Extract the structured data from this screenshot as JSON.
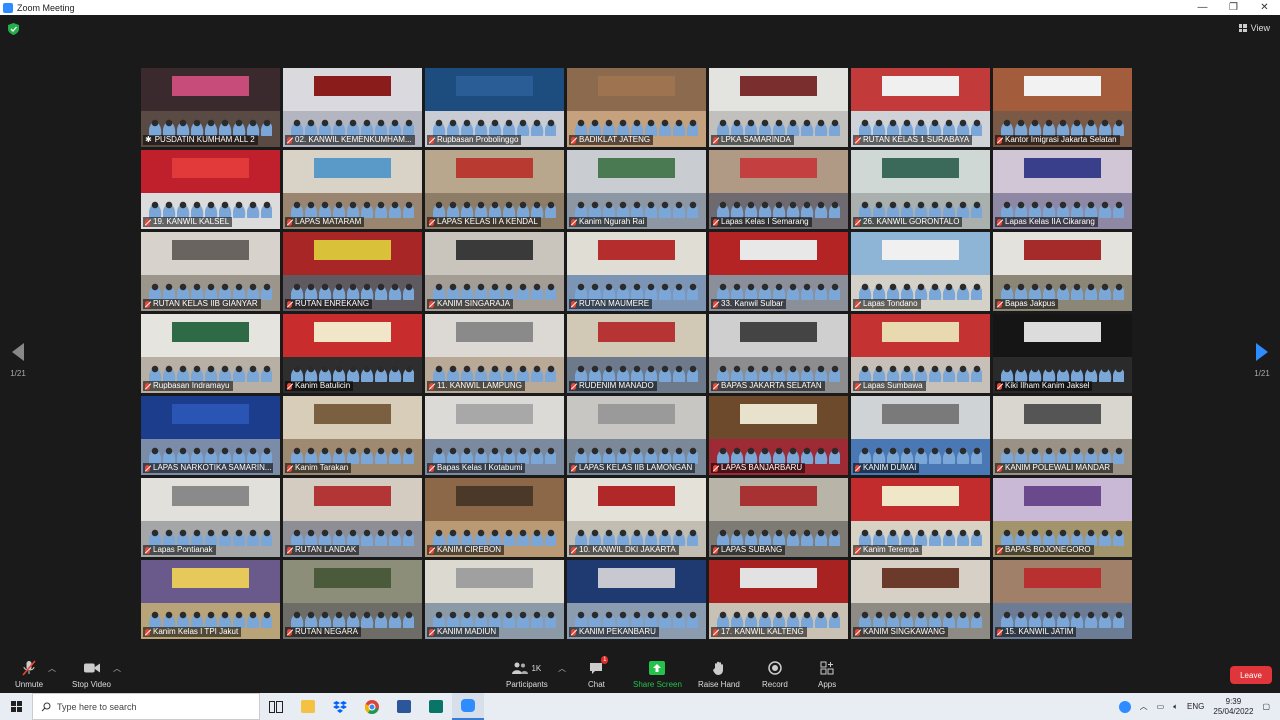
{
  "window": {
    "title": "Zoom Meeting",
    "controls": [
      "—",
      "❐",
      "✕"
    ]
  },
  "view": {
    "label": "View"
  },
  "pagination": {
    "left": "1/21",
    "right": "1/21"
  },
  "tiles": [
    {
      "label": "PUSDATIN KUMHAM ALL 2",
      "wall": "#3a2a2e",
      "floor": "#5a4a44",
      "banner": "#c84c7a",
      "active": true,
      "muted": false
    },
    {
      "label": "02. KANWIL KEMENKUMHAM...",
      "wall": "#d9d9de",
      "floor": "#b3b6c0",
      "banner": "#8a1c1c",
      "muted": true
    },
    {
      "label": "Rupbasan Probolinggo",
      "wall": "#1d4c7e",
      "floor": "#c9ccd3",
      "banner": "#2a5d95",
      "muted": true
    },
    {
      "label": "BADIKLAT JATENG",
      "wall": "#8b6a4e",
      "floor": "#c6a17e",
      "banner": "#9e7350",
      "muted": true
    },
    {
      "label": "LPKA SAMARINDA",
      "wall": "#e3e3e0",
      "floor": "#c2c0bc",
      "banner": "#7a2e2e",
      "muted": true
    },
    {
      "label": "RUTAN KELAS 1 SURABAYA",
      "wall": "#c33a3a",
      "floor": "#cfd2d6",
      "banner": "#f0f0f0",
      "muted": true
    },
    {
      "label": "Kantor Imigrasi Jakarta Selatan",
      "wall": "#a35c3c",
      "floor": "#7a5a46",
      "banner": "#f2f2f2",
      "muted": true
    },
    {
      "label": "19. KANWIL KALSEL",
      "wall": "#c0202c",
      "floor": "#dcdcdc",
      "banner": "#e23a3a",
      "muted": true
    },
    {
      "label": "LAPAS MATARAM",
      "wall": "#d8d2c7",
      "floor": "#9a8670",
      "banner": "#5a9ac8",
      "muted": true
    },
    {
      "label": "LAPAS KELAS II A KENDAL",
      "wall": "#b8a78c",
      "floor": "#8e7d66",
      "banner": "#b83a30",
      "muted": true
    },
    {
      "label": "Kanim Ngurah Rai",
      "wall": "#c9cdd2",
      "floor": "#8c97a3",
      "banner": "#4a7a52",
      "muted": true
    },
    {
      "label": "Lapas Kelas I Semarang",
      "wall": "#b09a86",
      "floor": "#6e6a70",
      "banner": "#c44040",
      "muted": true
    },
    {
      "label": "26. KANWIL GORONTALO",
      "wall": "#cfd8d4",
      "floor": "#a9b0ad",
      "banner": "#3c6a5a",
      "muted": true
    },
    {
      "label": "Lapas Kelas IIA Cikarang",
      "wall": "#d0c6d6",
      "floor": "#8f88a4",
      "banner": "#3a3f8c",
      "muted": true
    },
    {
      "label": "RUTAN KELAS IIB GIANYAR",
      "wall": "#d7d3cc",
      "floor": "#9c958b",
      "banner": "#6a6460",
      "muted": true
    },
    {
      "label": "RUTAN ENREKANG",
      "wall": "#a82626",
      "floor": "#5e5a60",
      "banner": "#d9c23a",
      "muted": true
    },
    {
      "label": "KANIM SINGARAJA",
      "wall": "#c9c4bc",
      "floor": "#a39d95",
      "banner": "#3a3a3a",
      "muted": true
    },
    {
      "label": "RUTAN MAUMERE",
      "wall": "#e0ddd4",
      "floor": "#7c95b4",
      "banner": "#b52d2d",
      "muted": true
    },
    {
      "label": "33. Kanwil Sulbar",
      "wall": "#b52424",
      "floor": "#8a8f9a",
      "banner": "#e8e8e8",
      "muted": true
    },
    {
      "label": "Lapas Tondano",
      "wall": "#8fb5d6",
      "floor": "#d4d2c8",
      "banner": "#f0f0f0",
      "muted": true
    },
    {
      "label": "Bapas Jakpus",
      "wall": "#e4e2dc",
      "floor": "#8c8677",
      "banner": "#a52a2a",
      "muted": true
    },
    {
      "label": "Rupbasan Indramayu",
      "wall": "#e6e4de",
      "floor": "#b8b0a4",
      "banner": "#2e6a46",
      "muted": true
    },
    {
      "label": "Kanim Batulicin",
      "wall": "#c82c2c",
      "floor": "#2e2e2e",
      "banner": "#f2e6c8",
      "muted": true
    },
    {
      "label": "11. KANWIL LAMPUNG",
      "wall": "#dcd9d4",
      "floor": "#b9a996",
      "banner": "#8a8a8a",
      "muted": true
    },
    {
      "label": "RUDENIM MANADO",
      "wall": "#d2c8b6",
      "floor": "#6c7a8c",
      "banner": "#b63434",
      "muted": true
    },
    {
      "label": "BAPAS JAKARTA SELATAN",
      "wall": "#cfcfd0",
      "floor": "#8d8d90",
      "banner": "#444",
      "muted": true
    },
    {
      "label": "Lapas Sumbawa",
      "wall": "#c43232",
      "floor": "#c6c0b8",
      "banner": "#e9d9b0",
      "muted": true
    },
    {
      "label": "Kiki Ilham Kanim Jaksel",
      "wall": "#151515",
      "floor": "#2a2a2a",
      "banner": "#dcdcdc",
      "muted": true
    },
    {
      "label": "LAPAS NARKOTIKA SAMARIN...",
      "wall": "#1c3c8c",
      "floor": "#7a8ca8",
      "banner": "#2a55b5",
      "muted": true
    },
    {
      "label": "Kanim Tarakan",
      "wall": "#d8cdb8",
      "floor": "#9e8a70",
      "banner": "#7a6040",
      "muted": true
    },
    {
      "label": "Bapas Kelas I Kotabumi",
      "wall": "#dcdad6",
      "floor": "#7c8aa0",
      "banner": "#a8a8a8",
      "muted": true
    },
    {
      "label": "LAPAS KELAS IIB LAMONGAN",
      "wall": "#c8c6c2",
      "floor": "#7a8898",
      "banner": "#9a9a9a",
      "muted": true
    },
    {
      "label": "LAPAS BANJARBARU",
      "wall": "#6e4a2c",
      "floor": "#9d2a34",
      "banner": "#e8e2cc",
      "muted": true
    },
    {
      "label": "KANIM DUMAI",
      "wall": "#cfd3d6",
      "floor": "#4a78b4",
      "banner": "#7a7a7a",
      "muted": true
    },
    {
      "label": "KANIM POLEWALI MANDAR",
      "wall": "#d9d6d0",
      "floor": "#9a9286",
      "banner": "#555",
      "muted": true
    },
    {
      "label": "Lapas Pontianak",
      "wall": "#e2e0da",
      "floor": "#a4a6a8",
      "banner": "#8a8a8a",
      "muted": true
    },
    {
      "label": "RUTAN LANDAK",
      "wall": "#d4ccc0",
      "floor": "#8e8f96",
      "banner": "#b33636",
      "muted": true
    },
    {
      "label": "KANIM CIREBON",
      "wall": "#8c6848",
      "floor": "#b99a74",
      "banner": "#4a3828",
      "muted": true
    },
    {
      "label": "10. KANWIL DKI JAKARTA",
      "wall": "#e4e1d8",
      "floor": "#c2bdb2",
      "banner": "#b22828",
      "muted": true
    },
    {
      "label": "LAPAS SUBANG",
      "wall": "#b9b4a8",
      "floor": "#7e7a74",
      "banner": "#a83232",
      "muted": true
    },
    {
      "label": "Kanim Terempa",
      "wall": "#c22c2c",
      "floor": "#d8d2c4",
      "banner": "#f0e6c8",
      "muted": true
    },
    {
      "label": "BAPAS BOJONEGORO",
      "wall": "#c9b8d6",
      "floor": "#a4946c",
      "banner": "#6a4a8c",
      "muted": true
    },
    {
      "label": "Kanim Kelas I TPI Jakut",
      "wall": "#6a5a8c",
      "floor": "#b8a478",
      "banner": "#e6c95a",
      "muted": true
    },
    {
      "label": "RUTAN NEGARA",
      "wall": "#8c8e7a",
      "floor": "#6e6c66",
      "banner": "#4a5a3a",
      "muted": true
    },
    {
      "label": "KANIM MADIUN",
      "wall": "#dcdad0",
      "floor": "#8c9aa8",
      "banner": "#a0a0a0",
      "muted": true
    },
    {
      "label": "KANIM PEKANBARU",
      "wall": "#1e3a70",
      "floor": "#8c9cb0",
      "banner": "#c8c8d0",
      "muted": true
    },
    {
      "label": "17. KANWIL KALTENG",
      "wall": "#a82222",
      "floor": "#c9c2b4",
      "banner": "#e2e2e2",
      "muted": true
    },
    {
      "label": "KANIM SINGKAWANG",
      "wall": "#d6d0c6",
      "floor": "#8e8a84",
      "banner": "#6c3a2a",
      "muted": true
    },
    {
      "label": "15. KANWIL JATIM",
      "wall": "#a08068",
      "floor": "#6c7c94",
      "banner": "#b83030",
      "muted": true
    }
  ],
  "toolbar": {
    "unmute": "Unmute",
    "stop_video": "Stop Video",
    "participants": "Participants",
    "participants_count": "1K",
    "chat": "Chat",
    "chat_badge": "1",
    "share_screen": "Share Screen",
    "raise_hand": "Raise Hand",
    "record": "Record",
    "apps": "Apps",
    "leave": "Leave"
  },
  "taskbar": {
    "search_placeholder": "Type here to search",
    "language": "ENG",
    "time": "9:39",
    "date": "25/04/2022"
  },
  "colors": {
    "accent": "#2d8cff",
    "share_green": "#24c24a",
    "leave_red": "#e0353a",
    "active_speaker": "#cfe33a"
  }
}
